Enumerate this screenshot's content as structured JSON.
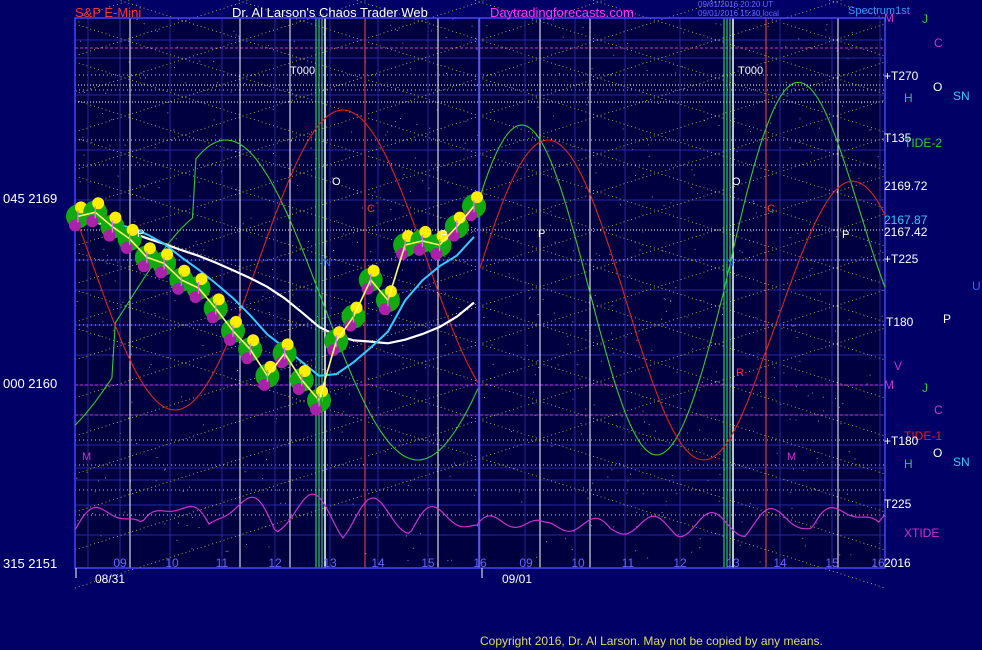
{
  "header": {
    "left": "S&P E-Mini",
    "center": "Dr. Al Larson's Chaos Trader Web",
    "site": "Daytradingforecasts.com",
    "stamp1": "09/01/2016 20:20 UT",
    "stamp2": "09/01/2016 15:30 local",
    "right": "Spectrum1st"
  },
  "copyright": "Copyright 2016, Dr. Al Larson. May not be copied by any means.",
  "colors": {
    "background": "#000066",
    "plot": "#000040",
    "grid": "#3333cc",
    "price_bar": "#ffff66",
    "tide1": "#dd2222",
    "tide2": "#33cc33",
    "xtide": "#cc33cc",
    "ma_white": "#ffffff",
    "ma_cyan": "#33ccff",
    "highlight_green": "#11aa11",
    "highlight_yellow": "#ffee00",
    "highlight_magenta": "#aa22aa"
  },
  "chart_data": {
    "type": "line",
    "title": "S&P E-Mini",
    "y_axis_labels": [
      "045 2169",
      "000 2160",
      "315 2151"
    ],
    "y_values": [
      2169,
      2160,
      2151
    ],
    "ylim": [
      2151,
      2170
    ],
    "x_tick_labels": [
      "09",
      "10",
      "11",
      "12",
      "13",
      "14",
      "15",
      "16",
      "09",
      "10",
      "11",
      "12",
      "13",
      "14",
      "15",
      "16"
    ],
    "date_labels": [
      "08/31",
      "09/01"
    ],
    "year_label": "2016",
    "price_values": [
      2168.1,
      2168.3,
      2167.6,
      2167.0,
      2166.1,
      2165.8,
      2165.0,
      2164.6,
      2163.6,
      2162.5,
      2161.6,
      2160.3,
      2161.4,
      2160.1,
      2159.1,
      2162.0,
      2163.2,
      2165.0,
      2164.0,
      2166.7,
      2166.9,
      2166.7,
      2167.6,
      2168.6
    ],
    "series": [
      {
        "name": "TIDE-1"
      },
      {
        "name": "TIDE-2"
      },
      {
        "name": "XTIDE"
      }
    ],
    "right_labels": [
      {
        "text": "M",
        "color": "#cc33cc"
      },
      {
        "text": "J",
        "color": "#33cc33"
      },
      {
        "text": "C",
        "color": "#cc33cc"
      },
      {
        "text": "+T270",
        "color": "#ffffff"
      },
      {
        "text": "O",
        "color": "#ffffff"
      },
      {
        "text": "H",
        "color": "#33cc33"
      },
      {
        "text": "SN",
        "color": "#33ccff"
      },
      {
        "text": "T135",
        "color": "#ffffff"
      },
      {
        "text": "TIDE-2",
        "color": "#33cc33"
      },
      {
        "text": "2169.72",
        "color": "#ffffff"
      },
      {
        "text": "2167.87",
        "color": "#33ccff"
      },
      {
        "text": "2167.42",
        "color": "#ffffff"
      },
      {
        "text": "+T225",
        "color": "#ffffff"
      },
      {
        "text": "U",
        "color": "#3366ff"
      },
      {
        "text": "T180",
        "color": "#ffffff"
      },
      {
        "text": "P",
        "color": "#ffffff"
      },
      {
        "text": "V",
        "color": "#cc33cc"
      },
      {
        "text": "M",
        "color": "#cc33cc"
      },
      {
        "text": "J",
        "color": "#33cc33"
      },
      {
        "text": "C",
        "color": "#cc33cc"
      },
      {
        "text": "TIDE-1",
        "color": "#dd2222"
      },
      {
        "text": "+T180",
        "color": "#ffffff"
      },
      {
        "text": "O",
        "color": "#ffffff"
      },
      {
        "text": "H",
        "color": "#33cc33"
      },
      {
        "text": "SN",
        "color": "#33ccff"
      },
      {
        "text": "T225",
        "color": "#ffffff"
      },
      {
        "text": "XTIDE",
        "color": "#cc33cc"
      },
      {
        "text": "2016",
        "color": "#ffffff"
      }
    ],
    "plot_markers": [
      "T000",
      "T000",
      "O",
      "O",
      "P",
      "P",
      "P",
      "P",
      "C",
      "C",
      "N",
      "N",
      "M",
      "M",
      "H",
      "R"
    ],
    "grid": true
  }
}
